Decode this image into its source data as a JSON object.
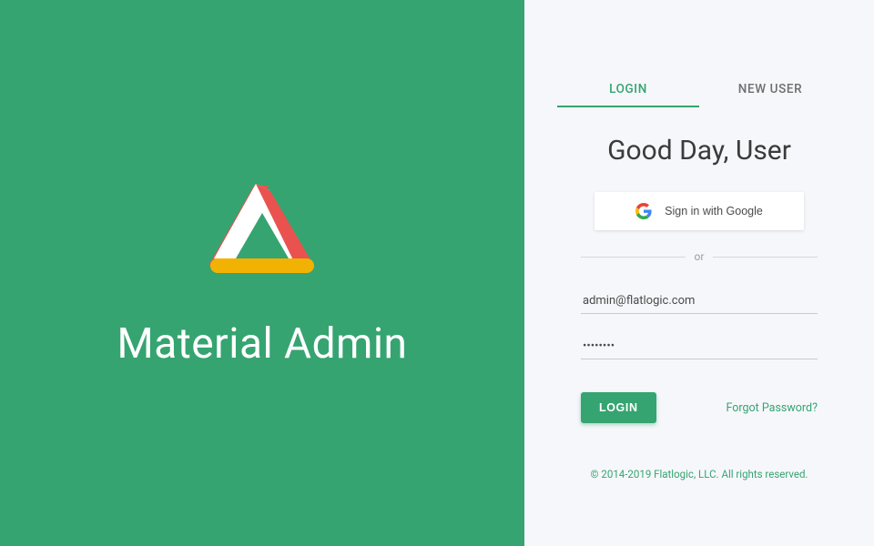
{
  "brand": {
    "title": "Material Admin"
  },
  "tabs": {
    "login": "LOGIN",
    "new_user": "NEW USER"
  },
  "greeting": "Good Day, User",
  "google_button": "Sign in with Google",
  "divider": "or",
  "fields": {
    "email_value": "admin@flatlogic.com",
    "password_value": "••••••••"
  },
  "actions": {
    "login": "LOGIN",
    "forgot": "Forgot Password?"
  },
  "copyright": "© 2014-2019 Flatlogic, LLC. All rights reserved.",
  "colors": {
    "accent": "#35a471",
    "page_bg": "#f6f7fb"
  }
}
